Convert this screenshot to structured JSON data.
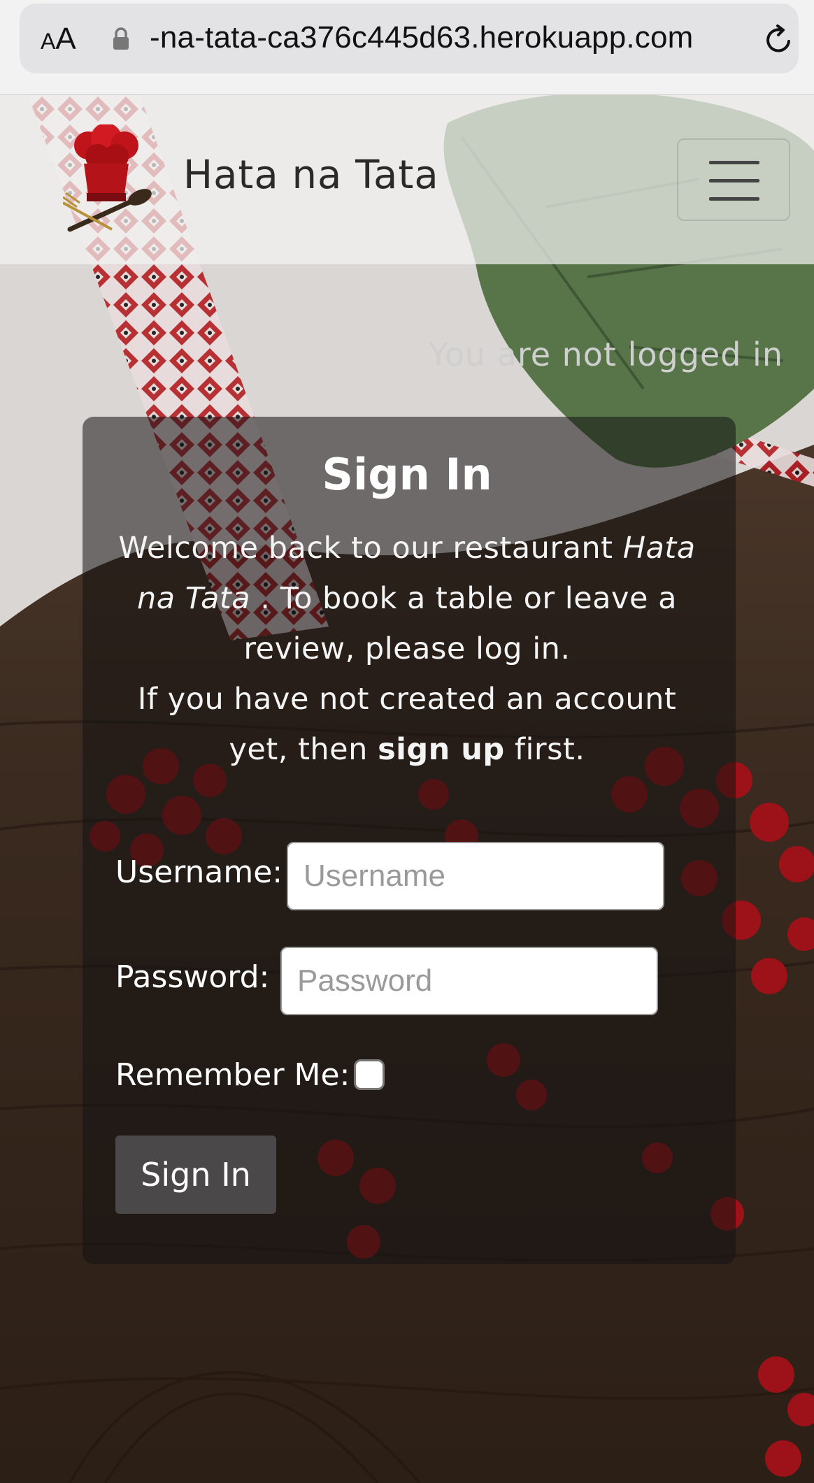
{
  "browser": {
    "text_size_label_small": "A",
    "text_size_label_large": "A",
    "url": "-na-tata-ca376c445d63.herokuapp.com"
  },
  "navbar": {
    "brand": "Hata na Tata"
  },
  "auth_status": "You are not logged in",
  "signin": {
    "title": "Sign In",
    "intro_1": "Welcome back to our restaurant ",
    "intro_name": "Hata na Tata",
    "intro_2": " . To book a table or leave a review, please log in.",
    "intro_3": "If you have not created an account yet, then ",
    "intro_link": "sign up",
    "intro_4": " first.",
    "username_label": "Username:",
    "username_placeholder": "Username",
    "password_label": "Password:",
    "password_placeholder": "Password",
    "remember_label": "Remember Me:",
    "submit_label": "Sign In"
  },
  "colors": {
    "berry": "#b0121a",
    "wood": "#3b2a1e",
    "leaf": "#5d7a45"
  }
}
